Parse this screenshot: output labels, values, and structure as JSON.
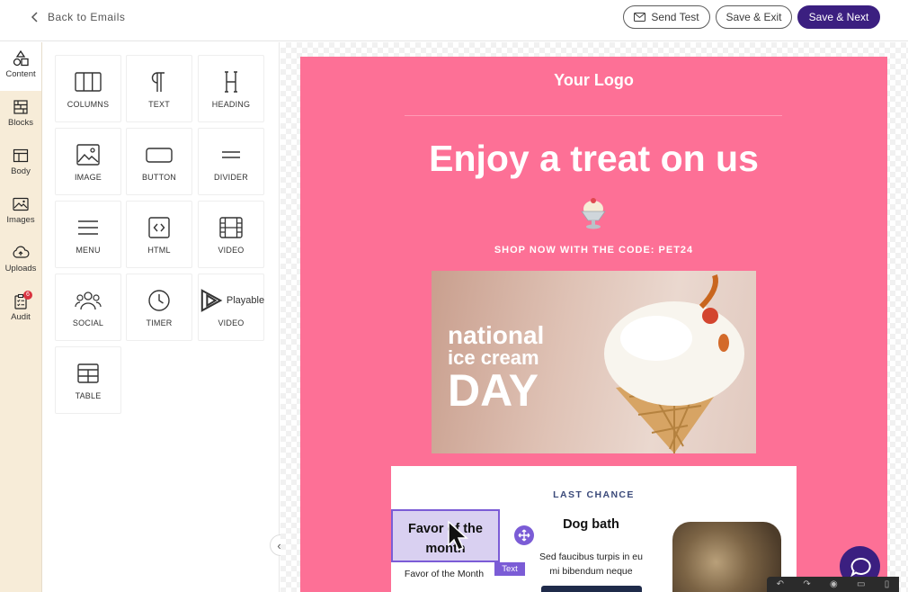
{
  "topbar": {
    "back_label": "Back to Emails",
    "send_test_label": "Send Test",
    "save_exit_label": "Save & Exit",
    "save_next_label": "Save & Next"
  },
  "rail": {
    "items": [
      {
        "label": "Content",
        "icon": "shapes-icon",
        "active": true
      },
      {
        "label": "Blocks",
        "icon": "blocks-icon"
      },
      {
        "label": "Body",
        "icon": "layout-icon"
      },
      {
        "label": "Images",
        "icon": "image-icon"
      },
      {
        "label": "Uploads",
        "icon": "cloud-upload-icon"
      },
      {
        "label": "Audit",
        "icon": "clipboard-check-icon",
        "badge": "6"
      }
    ]
  },
  "tiles": [
    {
      "label": "COLUMNS",
      "icon": "columns-icon"
    },
    {
      "label": "TEXT",
      "icon": "pilcrow-icon"
    },
    {
      "label": "HEADING",
      "icon": "heading-icon"
    },
    {
      "label": "IMAGE",
      "icon": "image-icon"
    },
    {
      "label": "BUTTON",
      "icon": "button-icon"
    },
    {
      "label": "DIVIDER",
      "icon": "divider-icon"
    },
    {
      "label": "MENU",
      "icon": "menu-icon"
    },
    {
      "label": "HTML",
      "icon": "code-icon"
    },
    {
      "label": "VIDEO",
      "icon": "film-icon"
    },
    {
      "label": "SOCIAL",
      "icon": "users-icon"
    },
    {
      "label": "TIMER",
      "icon": "clock-icon"
    },
    {
      "label": "VIDEO",
      "icon": "playable-icon",
      "brand": "Playable"
    },
    {
      "label": "TABLE",
      "icon": "table-icon"
    }
  ],
  "email": {
    "logo": "Your Logo",
    "headline": "Enjoy a treat on us",
    "code_line": "SHOP NOW WITH THE CODE: PET24",
    "hero": {
      "line1": "national",
      "line2": "ice cream",
      "line3": "DAY"
    },
    "card": {
      "kicker": "LAST CHANCE",
      "col1_title": "Favor of the month",
      "col1_sub": "Favor of the Month",
      "col2_title": "Dog bath",
      "col2_body": "Sed faucibus turpis in eu mi bibendum neque",
      "selection_tag": "Text"
    },
    "colors": {
      "background": "#fd7096",
      "accent": "#7b5cd6",
      "brand": "#3b1f80"
    }
  }
}
